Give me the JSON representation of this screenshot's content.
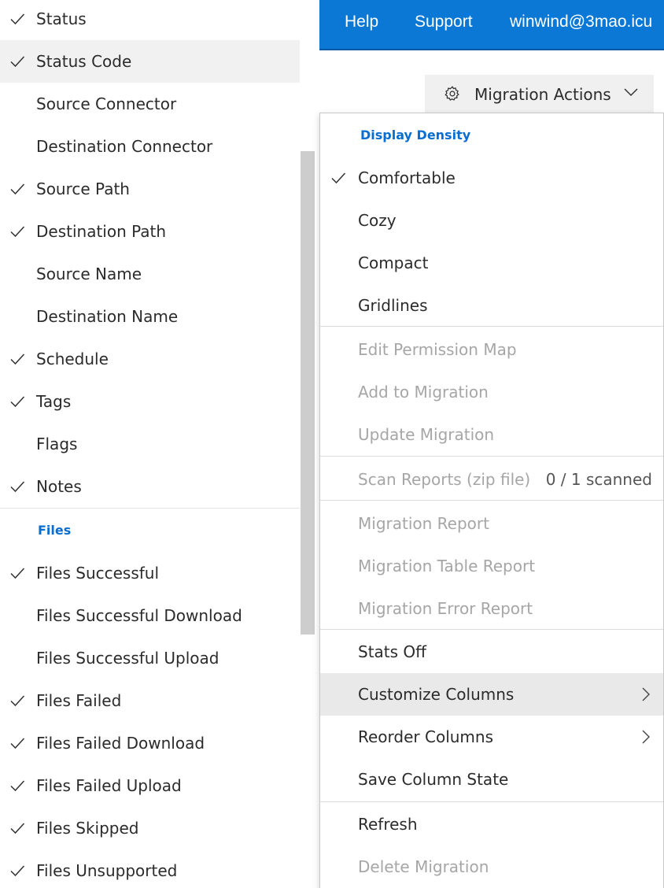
{
  "topbar": {
    "links": [
      "Help",
      "Support",
      "winwind@3mao.icu"
    ]
  },
  "actions_button": {
    "label": "Migration Actions",
    "icon": "gear-icon",
    "caret_icon": "chevron-down-icon"
  },
  "columns_menu": {
    "section_header": "Files",
    "hovered_item": "Status Code",
    "items": [
      {
        "label": "Status",
        "checked": true
      },
      {
        "label": "Status Code",
        "checked": true
      },
      {
        "label": "Source Connector",
        "checked": false
      },
      {
        "label": "Destination Connector",
        "checked": false
      },
      {
        "label": "Source Path",
        "checked": true
      },
      {
        "label": "Destination Path",
        "checked": true
      },
      {
        "label": "Source Name",
        "checked": false
      },
      {
        "label": "Destination Name",
        "checked": false
      },
      {
        "label": "Schedule",
        "checked": true
      },
      {
        "label": "Tags",
        "checked": true
      },
      {
        "label": "Flags",
        "checked": false
      },
      {
        "label": "Notes",
        "checked": true
      }
    ],
    "files_items": [
      {
        "label": "Files Successful",
        "checked": true
      },
      {
        "label": "Files Successful Download",
        "checked": false
      },
      {
        "label": "Files Successful Upload",
        "checked": false
      },
      {
        "label": "Files Failed",
        "checked": true
      },
      {
        "label": "Files Failed Download",
        "checked": true
      },
      {
        "label": "Files Failed Upload",
        "checked": true
      },
      {
        "label": "Files Skipped",
        "checked": true
      },
      {
        "label": "Files Unsupported",
        "checked": true
      }
    ]
  },
  "actions_menu": {
    "density_header": "Display Density",
    "density_options": [
      {
        "label": "Comfortable",
        "checked": true
      },
      {
        "label": "Cozy",
        "checked": false
      },
      {
        "label": "Compact",
        "checked": false
      },
      {
        "label": "Gridlines",
        "checked": false
      }
    ],
    "migration_items": [
      {
        "label": "Edit Permission Map",
        "disabled": true
      },
      {
        "label": "Add to Migration",
        "disabled": true
      },
      {
        "label": "Update Migration",
        "disabled": true
      }
    ],
    "scan_item": {
      "label": "Scan Reports (zip file)",
      "disabled": true,
      "meta": "0 / 1 scanned"
    },
    "report_items": [
      {
        "label": "Migration Report",
        "disabled": true
      },
      {
        "label": "Migration Table Report",
        "disabled": true
      },
      {
        "label": "Migration Error Report",
        "disabled": true
      }
    ],
    "column_items": [
      {
        "label": "Stats Off",
        "disabled": false,
        "submenu": false
      },
      {
        "label": "Customize Columns",
        "disabled": false,
        "submenu": true,
        "hovered": true
      },
      {
        "label": "Reorder Columns",
        "disabled": false,
        "submenu": true
      },
      {
        "label": "Save Column State",
        "disabled": false,
        "submenu": false
      }
    ],
    "final_items": [
      {
        "label": "Refresh",
        "disabled": false
      },
      {
        "label": "Delete Migration",
        "disabled": true
      }
    ]
  },
  "colors": {
    "accent_blue": "#0a78d4",
    "header_blue": "#0a6ed1",
    "disabled_text": "#a6a6a6",
    "hover_bg": "#e9e9e9"
  }
}
